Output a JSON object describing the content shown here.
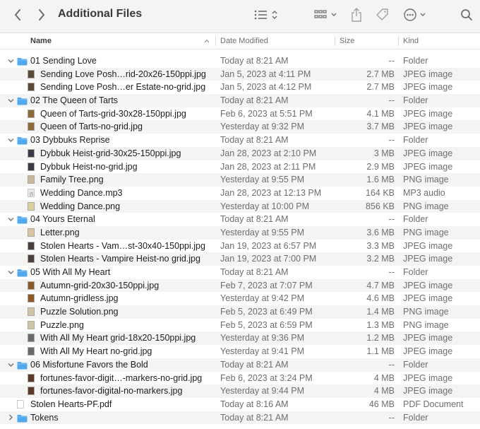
{
  "window": {
    "title": "Additional Files"
  },
  "colors": {
    "folder": "#52a8ec",
    "toolbar_bg": "#f6f4f2",
    "alt_row": "#f4f4f5"
  },
  "columns": {
    "name": "Name",
    "date": "Date Modified",
    "size": "Size",
    "kind": "Kind"
  },
  "rows": [
    {
      "level": 0,
      "type": "folder",
      "expanded": true,
      "name": "01 Sending Love",
      "date": "Today at 8:21 AM",
      "size": "--",
      "kind": "Folder"
    },
    {
      "level": 1,
      "type": "image",
      "thumb": "#5a4a3a",
      "name": "Sending Love Posh…rid-20x26-150ppi.jpg",
      "date": "Jan 5, 2023 at 4:11 PM",
      "size": "2.7 MB",
      "kind": "JPEG image"
    },
    {
      "level": 1,
      "type": "image",
      "thumb": "#5a4a3a",
      "name": "Sending Love Posh…er Estate-no-grid.jpg",
      "date": "Jan 5, 2023 at 4:12 PM",
      "size": "2.7 MB",
      "kind": "JPEG image"
    },
    {
      "level": 0,
      "type": "folder",
      "expanded": true,
      "name": "02 The Queen of Tarts",
      "date": "Today at 8:21 AM",
      "size": "--",
      "kind": "Folder"
    },
    {
      "level": 1,
      "type": "image",
      "thumb": "#8a6a3a",
      "name": "Queen of Tarts-grid-30x28-150ppi.jpg",
      "date": "Feb 6, 2023 at 5:51 PM",
      "size": "4.1 MB",
      "kind": "JPEG image"
    },
    {
      "level": 1,
      "type": "image",
      "thumb": "#8a6a3a",
      "name": "Queen of Tarts-no-grid.jpg",
      "date": "Yesterday at 9:32 PM",
      "size": "3.7 MB",
      "kind": "JPEG image"
    },
    {
      "level": 0,
      "type": "folder",
      "expanded": true,
      "name": "03 Dybbuks Reprise",
      "date": "Today at 8:21 AM",
      "size": "--",
      "kind": "Folder"
    },
    {
      "level": 1,
      "type": "image",
      "thumb": "#3a3a46",
      "name": "Dybbuk Heist-grid-30x25-150ppi.jpg",
      "date": "Jan 28, 2023 at 2:10 PM",
      "size": "3 MB",
      "kind": "JPEG image"
    },
    {
      "level": 1,
      "type": "image",
      "thumb": "#3a3a46",
      "name": "Dybbuk Heist-no-grid.jpg",
      "date": "Jan 28, 2023 at 2:11 PM",
      "size": "2.9 MB",
      "kind": "JPEG image"
    },
    {
      "level": 1,
      "type": "image",
      "thumb": "#c9b89a",
      "name": "Family Tree.png",
      "date": "Yesterday at 9:55 PM",
      "size": "1.6 MB",
      "kind": "PNG image"
    },
    {
      "level": 1,
      "type": "audio",
      "thumb": "#e8e8e8",
      "name": "Wedding Dance.mp3",
      "date": "Jan 28, 2023 at 12:13 PM",
      "size": "164 KB",
      "kind": "MP3 audio"
    },
    {
      "level": 1,
      "type": "image",
      "thumb": "#d9cfa0",
      "name": "Wedding Dance.png",
      "date": "Yesterday at 10:00 PM",
      "size": "856 KB",
      "kind": "PNG image"
    },
    {
      "level": 0,
      "type": "folder",
      "expanded": true,
      "name": "04 Yours Eternal",
      "date": "Today at 8:21 AM",
      "size": "--",
      "kind": "Folder"
    },
    {
      "level": 1,
      "type": "image",
      "thumb": "#d8c4a0",
      "name": "Letter.png",
      "date": "Yesterday at 9:55 PM",
      "size": "3.6 MB",
      "kind": "PNG image"
    },
    {
      "level": 1,
      "type": "image",
      "thumb": "#4a4040",
      "name": "Stolen Hearts - Vam…st-30x40-150ppi.jpg",
      "date": "Jan 19, 2023 at 6:57 PM",
      "size": "3.3 MB",
      "kind": "JPEG image"
    },
    {
      "level": 1,
      "type": "image",
      "thumb": "#4a4040",
      "name": "Stolen Hearts - Vampire Heist-no grid.jpg",
      "date": "Jan 19, 2023 at 7:00 PM",
      "size": "3.2 MB",
      "kind": "JPEG image"
    },
    {
      "level": 0,
      "type": "folder",
      "expanded": true,
      "name": "05 With All My Heart",
      "date": "Today at 8:21 AM",
      "size": "--",
      "kind": "Folder"
    },
    {
      "level": 1,
      "type": "image",
      "thumb": "#8a5a2a",
      "name": "Autumn-grid-20x30-150ppi.jpg",
      "date": "Feb 7, 2023 at 7:07 PM",
      "size": "4.7 MB",
      "kind": "JPEG image"
    },
    {
      "level": 1,
      "type": "image",
      "thumb": "#8a5a2a",
      "name": "Autumn-gridless.jpg",
      "date": "Yesterday at 9:42 PM",
      "size": "4.6 MB",
      "kind": "JPEG image"
    },
    {
      "level": 1,
      "type": "image",
      "thumb": "#cfc3a8",
      "name": "Puzzle Solution.png",
      "date": "Feb 5, 2023 at 6:49 PM",
      "size": "1.4 MB",
      "kind": "PNG image"
    },
    {
      "level": 1,
      "type": "image",
      "thumb": "#cfc3a8",
      "name": "Puzzle.png",
      "date": "Feb 5, 2023 at 6:59 PM",
      "size": "1.3 MB",
      "kind": "PNG image"
    },
    {
      "level": 1,
      "type": "image",
      "thumb": "#6a6a6a",
      "name": "With All My Heart grid-18x20-150ppi.jpg",
      "date": "Yesterday at 9:36 PM",
      "size": "1.2 MB",
      "kind": "JPEG image"
    },
    {
      "level": 1,
      "type": "image",
      "thumb": "#6a6a6a",
      "name": "With All My Heart no-grid.jpg",
      "date": "Yesterday at 9:41 PM",
      "size": "1.1 MB",
      "kind": "JPEG image"
    },
    {
      "level": 0,
      "type": "folder",
      "expanded": true,
      "name": "06 Misfortune Favors the Bold",
      "date": "Today at 8:21 AM",
      "size": "--",
      "kind": "Folder"
    },
    {
      "level": 1,
      "type": "image",
      "thumb": "#5a3a2a",
      "name": "fortunes-favor-digit…-markers-no-grid.jpg",
      "date": "Feb 6, 2023 at 3:24 PM",
      "size": "4 MB",
      "kind": "JPEG image"
    },
    {
      "level": 1,
      "type": "image",
      "thumb": "#5a3a2a",
      "name": "fortunes-favor-digital-no-markers.jpg",
      "date": "Yesterday at 9:44 PM",
      "size": "4 MB",
      "kind": "JPEG image"
    },
    {
      "level": 0,
      "type": "pdf",
      "name": "Stolen Hearts-PF.pdf",
      "date": "Today at 8:16 AM",
      "size": "46 MB",
      "kind": "PDF Document"
    },
    {
      "level": 0,
      "type": "folder",
      "expanded": false,
      "name": "Tokens",
      "date": "Today at 8:21 AM",
      "size": "--",
      "kind": "Folder"
    }
  ]
}
